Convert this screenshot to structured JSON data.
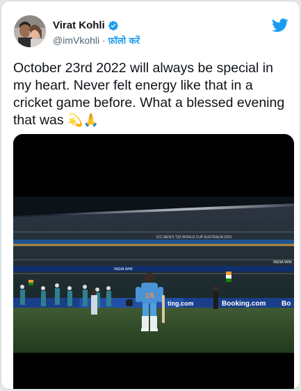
{
  "tweet": {
    "display_name": "Virat Kohli",
    "handle": "@imVkohli",
    "separator": "·",
    "follow_label": "फ़ॉलो करें",
    "text": "October 23rd 2022 will always be special in my heart. Never felt energy like that in a cricket game before. What a blessed evening that was",
    "emoji_1": "💫",
    "emoji_2": "🙏"
  },
  "photo": {
    "player_number": "18",
    "board_ad_text": "Booking.com",
    "board_ad_text_short": "Bo",
    "board_left_text": "ting.com",
    "ribbon_left": "INDIA WIN",
    "ribbon_right": "INDIA WIN",
    "banner_text": "ICC MEN'S T20 WORLD CUP AUSTRALIA 2022"
  },
  "colors": {
    "verified": "#1d9bf0",
    "twitter_blue": "#1d9bf0",
    "text": "#0f1419",
    "secondary": "#536471"
  }
}
